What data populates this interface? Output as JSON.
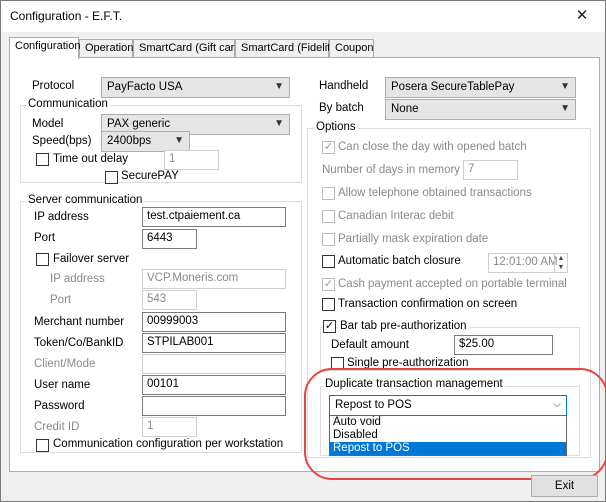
{
  "window": {
    "title": "Configuration - E.F.T.",
    "close_glyph": "✕"
  },
  "tabs": [
    {
      "label": "Configuration"
    },
    {
      "label": "Operation"
    },
    {
      "label": "SmartCard (Gift card)"
    },
    {
      "label": "SmartCard (Fidelity)"
    },
    {
      "label": "Coupon"
    }
  ],
  "left": {
    "protocol_label": "Protocol",
    "protocol_value": "PayFacto USA",
    "communication": {
      "title": "Communication",
      "model_label": "Model",
      "model_value": "PAX generic",
      "speed_label": "Speed(bps)",
      "speed_value": "2400bps",
      "timeout_label": "Time out delay",
      "timeout_value": "1",
      "securepay_label": "SecurePAY"
    },
    "server": {
      "title": "Server communication",
      "ip_label": "IP address",
      "ip_value": "test.ctpaiement.ca",
      "port_label": "Port",
      "port_value": "6443",
      "failover_label": "Failover server",
      "failover_ip_label": "IP address",
      "failover_ip_value": "VCP.Moneris.com",
      "failover_port_label": "Port",
      "failover_port_value": "543",
      "merchant_label": "Merchant number",
      "merchant_value": "00999003",
      "token_label": "Token/Co/BankID",
      "token_value": "STPILAB001",
      "client_label": "Client/Mode",
      "client_value": "",
      "user_label": "User name",
      "user_value": "00101",
      "password_label": "Password",
      "password_value": "",
      "credit_label": "Credit ID",
      "credit_value": "1",
      "per_ws_label": "Communication configuration per workstation"
    }
  },
  "right": {
    "handheld_label": "Handheld",
    "handheld_value": "Posera SecureTablePay",
    "batch_label": "By batch",
    "batch_value": "None",
    "options": {
      "title": "Options",
      "close_day": "Can close the day with opened batch",
      "days_label": "Number of days in memory",
      "days_value": "7",
      "phone_tx": "Allow telephone obtained transactions",
      "interac": "Canadian Interac debit",
      "mask_exp": "Partially mask expiration date",
      "auto_batch": "Automatic batch closure",
      "auto_batch_time": "12:01:00 AM",
      "cash_payment": "Cash payment accepted on portable terminal",
      "tx_confirm": "Transaction confirmation on screen",
      "bar_tab": "Bar tab pre-authorization",
      "default_amount_label": "Default amount",
      "default_amount_value": "$25.00",
      "single_preauth": "Single pre-authorization"
    },
    "duplicate": {
      "title": "Duplicate transaction management",
      "value": "Repost to POS",
      "options": [
        "Auto void",
        "Disabled",
        "Repost to POS"
      ]
    }
  },
  "buttons": {
    "exit": "Exit"
  },
  "colors": {
    "highlight": "#0078d7",
    "annotation": "#e64545"
  }
}
